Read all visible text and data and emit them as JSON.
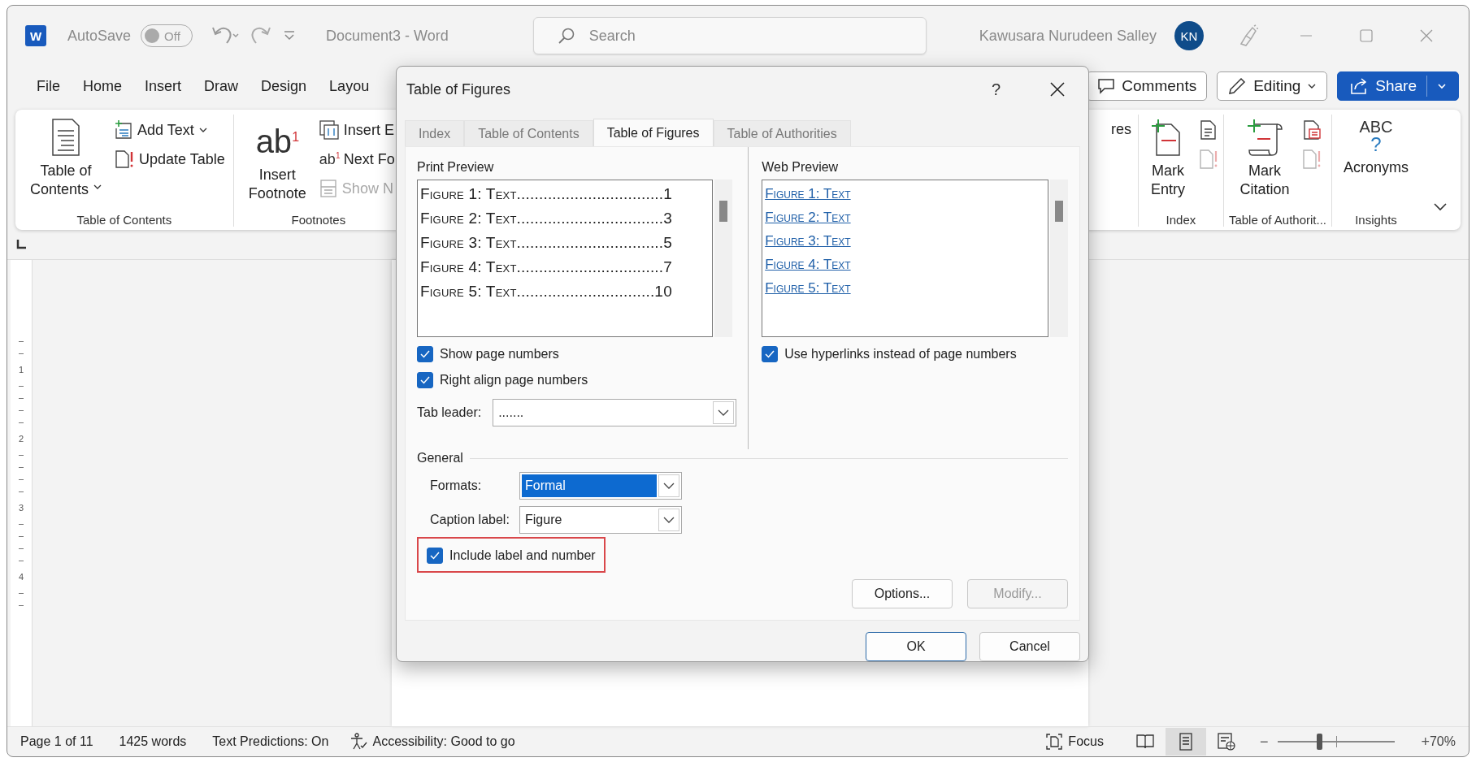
{
  "title_bar": {
    "logo_letter": "W",
    "autosave": {
      "label": "AutoSave",
      "on": false,
      "state_text": "Off"
    },
    "document_title": "Document3  -  Word",
    "search": {
      "placeholder": "Search"
    },
    "user_name": "Kawusara Nurudeen Salley",
    "avatar_initials": "KN"
  },
  "menu_tabs": [
    {
      "label": "File"
    },
    {
      "label": "Home"
    },
    {
      "label": "Insert"
    },
    {
      "label": "Draw"
    },
    {
      "label": "Design"
    },
    {
      "label": "Layou"
    }
  ],
  "header_buttons": {
    "comments": "Comments",
    "editing": "Editing",
    "share": "Share"
  },
  "ribbon": {
    "left_groups": [
      {
        "label": "Table of Contents",
        "large": {
          "kind": "toc",
          "lines": [
            "Table of",
            "Contents"
          ],
          "dropdown": true
        },
        "small": [
          {
            "kind": "add-text",
            "label": "Add Text",
            "dropdown": true,
            "disabled": false
          },
          {
            "kind": "update-table",
            "label": "Update Table",
            "dropdown": false,
            "disabled": false
          }
        ]
      },
      {
        "label": "Footnotes",
        "large": {
          "kind": "footnote",
          "icon_text": "ab",
          "icon_sup": "1",
          "lines": [
            "Insert",
            "Footnote"
          ],
          "dropdown": false
        },
        "small": [
          {
            "kind": "endnote",
            "label": "Insert E",
            "dropdown": false,
            "disabled": false
          },
          {
            "kind": "next-footnote",
            "icon_text": "ab",
            "icon_sup": "1",
            "label": "Next Fo",
            "dropdown": false,
            "disabled": false
          },
          {
            "kind": "show-notes",
            "label": "Show N",
            "dropdown": false,
            "disabled": true
          }
        ]
      }
    ],
    "partial_label": "res",
    "right_groups": [
      {
        "label": "Index",
        "large": {
          "kind": "mark-entry",
          "lines": [
            "Mark",
            "Entry"
          ]
        },
        "icons": [
          {
            "kind": "doc",
            "disabled": false
          },
          {
            "kind": "doc-alert",
            "disabled": true
          }
        ]
      },
      {
        "label": "Table of Authorit...",
        "large": {
          "kind": "mark-citation",
          "lines": [
            "Mark",
            "Citation"
          ]
        },
        "icons": [
          {
            "kind": "doc-red",
            "disabled": false
          },
          {
            "kind": "doc-alert",
            "disabled": true
          }
        ]
      },
      {
        "label": "Insights",
        "large": {
          "kind": "acronyms",
          "icon_text": [
            "ABC",
            "?"
          ],
          "lines": [
            "Acronyms"
          ]
        }
      }
    ]
  },
  "ruler_numbers": [
    "1",
    "2",
    "3",
    "4"
  ],
  "dialog": {
    "title": "Table of Figures",
    "help": "?",
    "tabs": [
      {
        "label": "Index",
        "selected": false
      },
      {
        "label": "Table of Contents",
        "selected": false
      },
      {
        "label": "Table of Figures",
        "selected": true
      },
      {
        "label": "Table of Authorities",
        "selected": false
      }
    ],
    "print_preview": {
      "label": "Print Preview",
      "lines": [
        "Figure 1: Text.................................1",
        "Figure 2: Text.................................3",
        "Figure 3: Text.................................5",
        "Figure 4: Text.................................7",
        "Figure 5: Text...............................10"
      ]
    },
    "show_page_numbers": {
      "label": "Show page numbers",
      "checked": true
    },
    "right_align": {
      "label": "Right align page numbers",
      "checked": true
    },
    "tab_leader": {
      "label": "Tab leader:",
      "value": "......."
    },
    "web_preview": {
      "label": "Web Preview",
      "links": [
        "Figure 1: Text",
        "Figure 2: Text",
        "Figure 3: Text",
        "Figure 4: Text",
        "Figure 5: Text"
      ]
    },
    "use_hyperlinks": {
      "label": "Use hyperlinks instead of page numbers",
      "checked": true
    },
    "general": {
      "label": "General",
      "formats": {
        "label": "Formats:",
        "value": "Formal",
        "selected": true
      },
      "caption_label": {
        "label": "Caption label:",
        "value": "Figure",
        "selected": false
      },
      "include_label": {
        "label": "Include label and number",
        "checked": true,
        "highlighted": true
      }
    },
    "buttons": [
      {
        "label": "Options...",
        "disabled": false,
        "default": false
      },
      {
        "label": "Modify...",
        "disabled": true,
        "default": false
      }
    ],
    "footer_buttons": [
      {
        "label": "OK",
        "disabled": false,
        "default": true
      },
      {
        "label": "Cancel",
        "disabled": false,
        "default": false
      }
    ]
  },
  "status_bar": {
    "page": "Page 1 of 11",
    "words": "1425 words",
    "predictions": "Text Predictions: On",
    "accessibility": "Accessibility: Good to go",
    "focus": "Focus",
    "views": [
      {
        "kind": "read",
        "selected": false
      },
      {
        "kind": "print",
        "selected": true
      },
      {
        "kind": "web",
        "selected": false
      }
    ],
    "zoom": {
      "minus": "−",
      "plus": "+",
      "level": 0.35,
      "value": "70%"
    }
  }
}
